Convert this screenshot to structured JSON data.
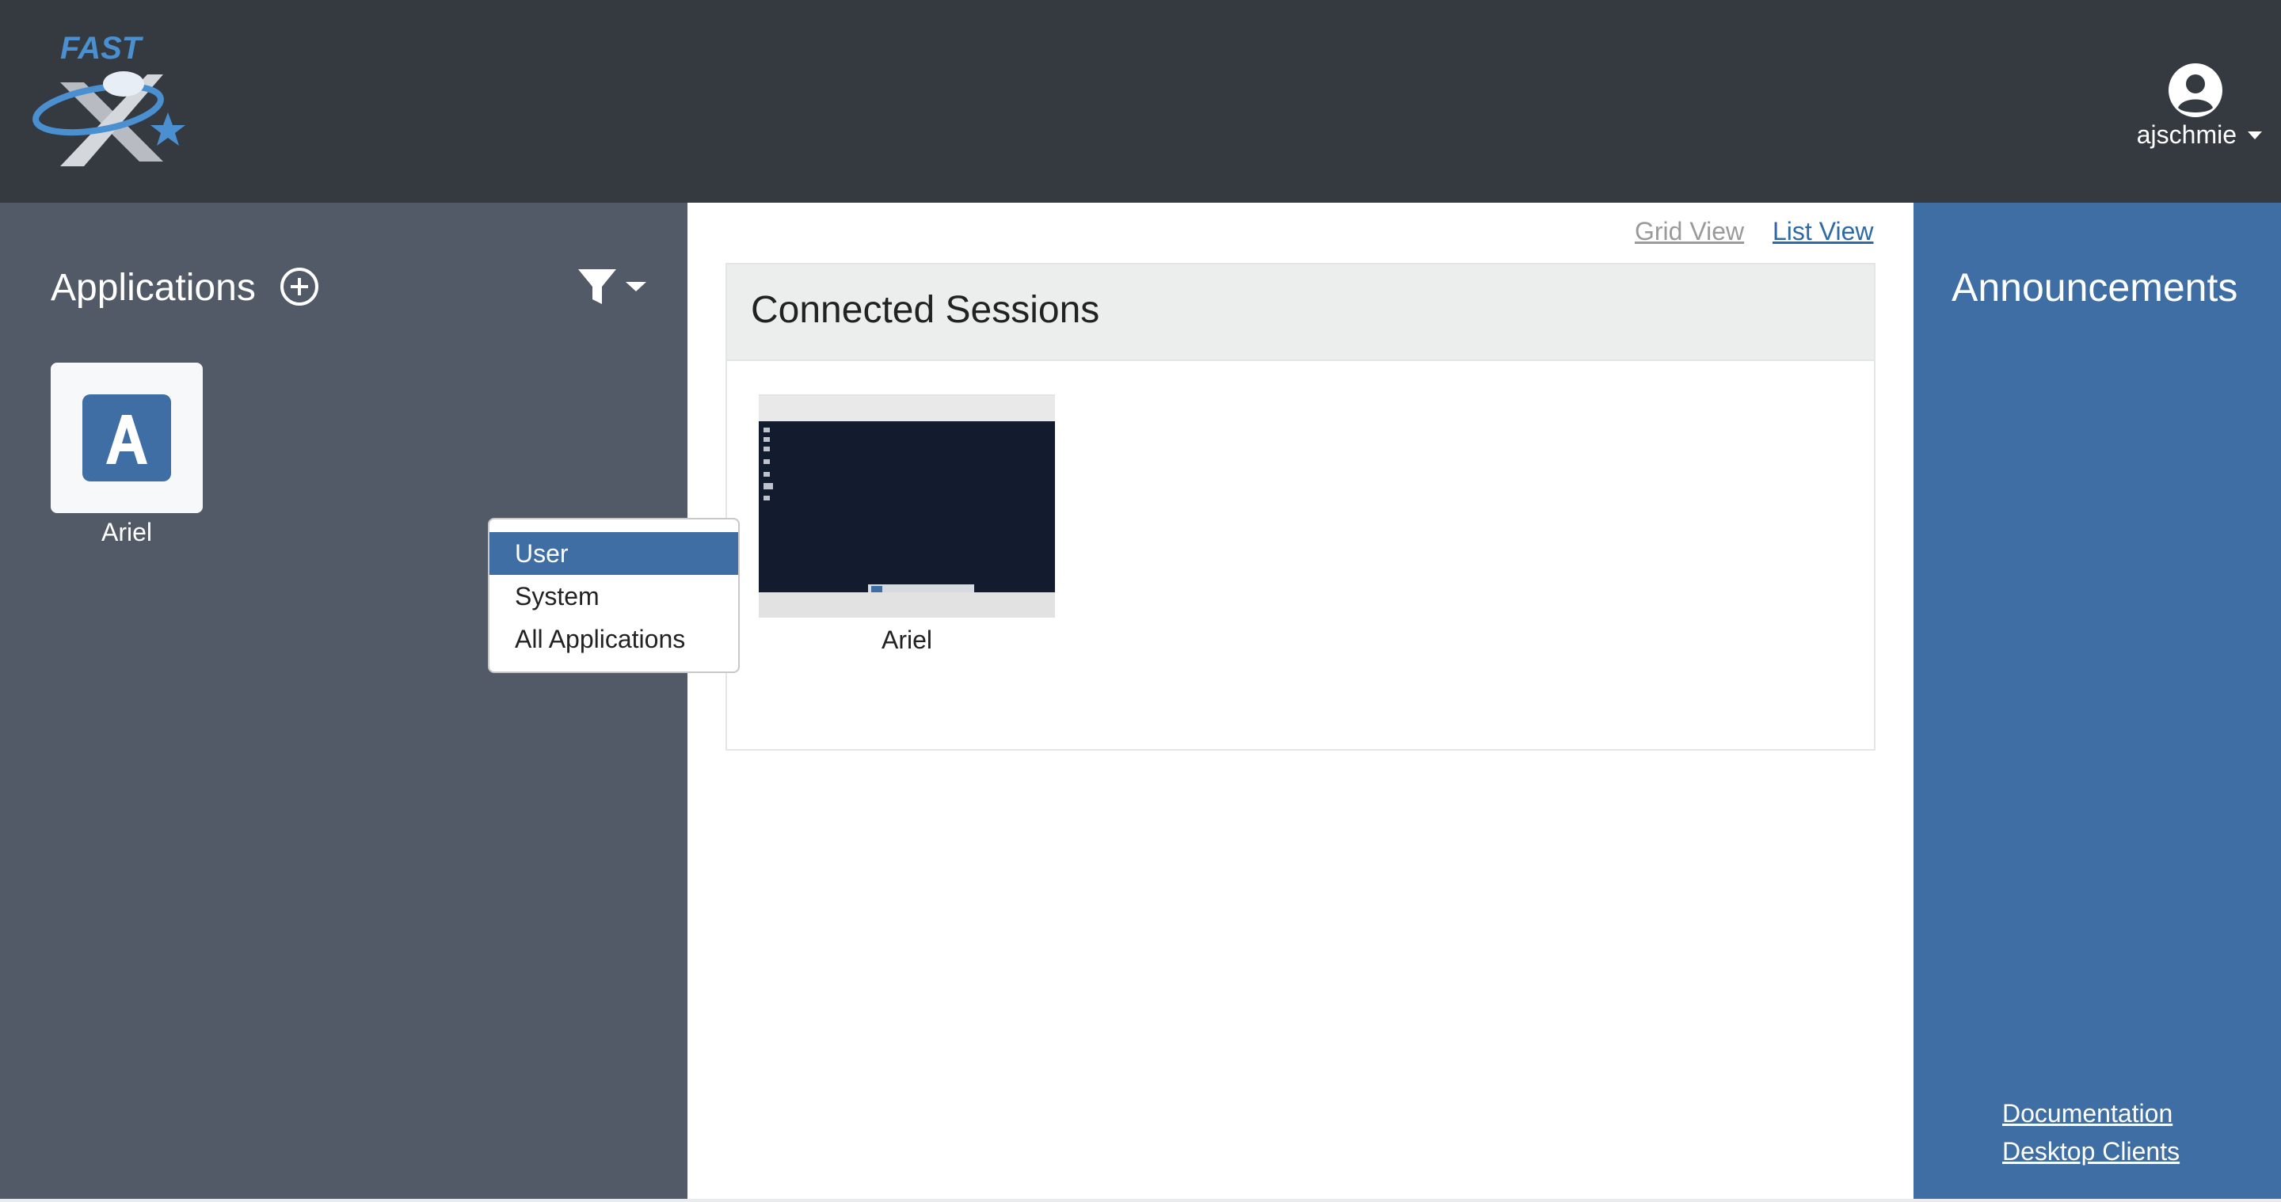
{
  "header": {
    "logo_text": "FAST",
    "username": "ajschmie"
  },
  "sidebar": {
    "title": "Applications",
    "apps": [
      {
        "label": "Ariel",
        "icon_letter": "A"
      }
    ],
    "filter_menu": {
      "items": [
        "User",
        "System",
        "All Applications"
      ],
      "selected": "User"
    }
  },
  "main": {
    "view_links": {
      "grid": "Grid View",
      "list": "List View"
    },
    "sessions_title": "Connected Sessions",
    "sessions": [
      {
        "label": "Ariel"
      }
    ]
  },
  "announcements": {
    "title": "Announcements",
    "links": [
      "Documentation",
      "Desktop Clients"
    ]
  },
  "colors": {
    "header_bg": "#343a40",
    "sidebar_bg": "#515a66",
    "accent": "#3f6ea5",
    "link": "#2f6aa8"
  }
}
